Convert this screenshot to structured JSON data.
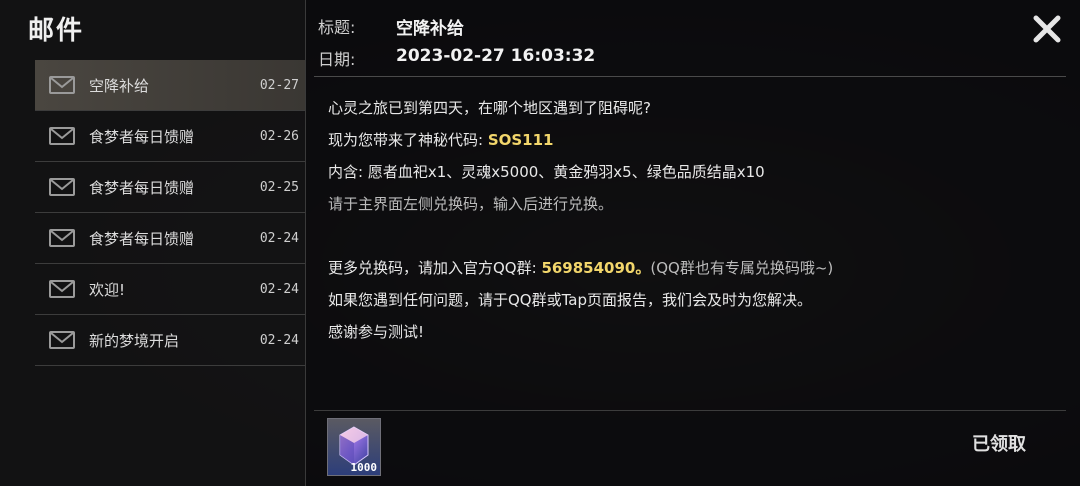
{
  "panel": {
    "title": "邮件"
  },
  "mails": [
    {
      "subject": "空降补给",
      "date": "02-27",
      "selected": true
    },
    {
      "subject": "食梦者每日馈赠",
      "date": "02-26",
      "selected": false
    },
    {
      "subject": "食梦者每日馈赠",
      "date": "02-25",
      "selected": false
    },
    {
      "subject": "食梦者每日馈赠",
      "date": "02-24",
      "selected": false
    },
    {
      "subject": "欢迎!",
      "date": "02-24",
      "selected": false
    },
    {
      "subject": "新的梦境开启",
      "date": "02-24",
      "selected": false
    }
  ],
  "detail": {
    "title_label": "标题:",
    "title_value": "空降补给",
    "date_label": "日期:",
    "date_value": "2023-02-27 16:03:32",
    "line1": "心灵之旅已到第四天，在哪个地区遇到了阻碍呢?",
    "line2_prefix": "现为您带来了神秘代码: ",
    "line2_code": "SOS111",
    "line3": "内含: 愿者血祀x1、灵魂x5000、黄金鸦羽x5、绿色品质结晶x10",
    "line4": "请于主界面左侧兑换码，输入后进行兑换。",
    "line5_prefix": "更多兑换码，请加入官方QQ群: ",
    "line5_group": "569854090。",
    "line5_suffix": "(QQ群也有专属兑换码哦~)",
    "line6": "如果您遇到任何问题，请于QQ群或Tap页面报告，我们会及时为您解决。",
    "line7": "感谢参与测试!"
  },
  "reward": {
    "count": "1000",
    "icon": "crystal-icon"
  },
  "claim_status": "已领取",
  "colors": {
    "highlight": "#f2d66b",
    "selected_row": "#4a4640"
  }
}
